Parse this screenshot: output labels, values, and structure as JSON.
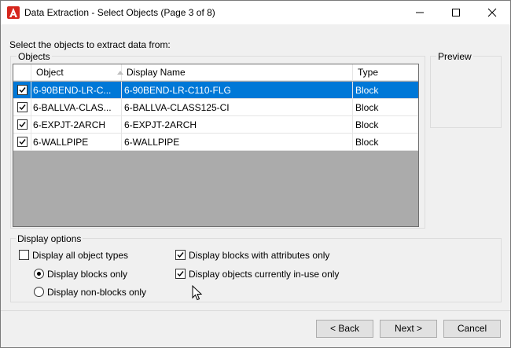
{
  "window": {
    "title": "Data Extraction - Select Objects (Page 3 of 8)",
    "app_icon": "autocad-a-icon"
  },
  "prompt": "Select the objects to extract data from:",
  "objects_group": {
    "label": "Objects",
    "columns": [
      {
        "label": "Object",
        "sort": "ascending"
      },
      {
        "label": "Display Name"
      },
      {
        "label": "Type"
      }
    ],
    "rows": [
      {
        "checked": true,
        "object": "6-90BEND-LR-C...",
        "display_name": "6-90BEND-LR-C110-FLG",
        "type": "Block",
        "selected": true
      },
      {
        "checked": true,
        "object": "6-BALLVA-CLAS...",
        "display_name": "6-BALLVA-CLASS125-CI",
        "type": "Block",
        "selected": false
      },
      {
        "checked": true,
        "object": "6-EXPJT-2ARCH",
        "display_name": "6-EXPJT-2ARCH",
        "type": "Block",
        "selected": false
      },
      {
        "checked": true,
        "object": "6-WALLPIPE",
        "display_name": "6-WALLPIPE",
        "type": "Block",
        "selected": false
      }
    ]
  },
  "preview": {
    "label": "Preview"
  },
  "display_options": {
    "label": "Display options",
    "all_types": {
      "label": "Display all object types",
      "checked": false
    },
    "blocks_only": {
      "label": "Display blocks only",
      "selected": true
    },
    "non_blocks_only": {
      "label": "Display non-blocks only",
      "selected": false
    },
    "with_attributes": {
      "label": "Display blocks with attributes only",
      "checked": true
    },
    "in_use": {
      "label": "Display objects currently in-use only",
      "checked": true
    }
  },
  "buttons": {
    "back": "< Back",
    "next": "Next >",
    "cancel": "Cancel"
  },
  "colors": {
    "selection": "#0078d7",
    "list_background": "#ababab",
    "dialog_background": "#f0f0f0",
    "app_icon": "#d6261d"
  }
}
